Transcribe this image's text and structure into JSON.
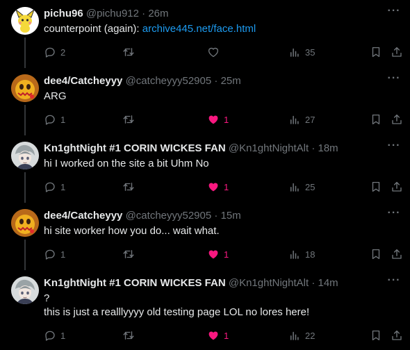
{
  "tweets": [
    {
      "name": "pichu96",
      "handle": "@pichu912",
      "time": "26m",
      "text_prefix": "counterpoint (again): ",
      "link": "archive445.net/face.html",
      "lines": [],
      "replies": "2",
      "retweets": "",
      "likes": "",
      "liked": false,
      "views": "35",
      "avatar": "pichu"
    },
    {
      "name": "dee4/Catcheyyy",
      "handle": "@catcheyyy52905",
      "time": "25m",
      "text_prefix": "",
      "link": "",
      "lines": [
        "ARG"
      ],
      "replies": "1",
      "retweets": "",
      "likes": "1",
      "liked": true,
      "views": "27",
      "avatar": "dee"
    },
    {
      "name": "Kn1ghtNight #1 CORIN WICKES FAN",
      "handle": "@Kn1ghtNightAlt",
      "time": "18m",
      "text_prefix": "",
      "link": "",
      "lines": [
        "hi I worked on the site a bit Uhm No"
      ],
      "replies": "1",
      "retweets": "",
      "likes": "1",
      "liked": true,
      "views": "25",
      "avatar": "knight"
    },
    {
      "name": "dee4/Catcheyyy",
      "handle": "@catcheyyy52905",
      "time": "15m",
      "text_prefix": "",
      "link": "",
      "lines": [
        "hi site worker how you do... wait what."
      ],
      "replies": "1",
      "retweets": "",
      "likes": "1",
      "liked": true,
      "views": "18",
      "avatar": "dee"
    },
    {
      "name": "Kn1ghtNight #1 CORIN WICKES FAN",
      "handle": "@Kn1ghtNightAlt",
      "time": "14m",
      "text_prefix": "",
      "link": "",
      "lines": [
        "?",
        "this is just a realllyyyy old testing page LOL no lores here!"
      ],
      "replies": "1",
      "retweets": "",
      "likes": "1",
      "liked": true,
      "views": "22",
      "avatar": "knight"
    }
  ],
  "icons": {
    "reply": "reply-icon",
    "retweet": "retweet-icon",
    "like": "heart-icon",
    "views": "views-icon",
    "bookmark": "bookmark-icon",
    "share": "share-icon",
    "more": "more-icon"
  },
  "colors": {
    "background": "#000000",
    "text": "#e7e9ea",
    "muted": "#71767b",
    "link": "#1d9bf0",
    "like": "#f91880"
  }
}
